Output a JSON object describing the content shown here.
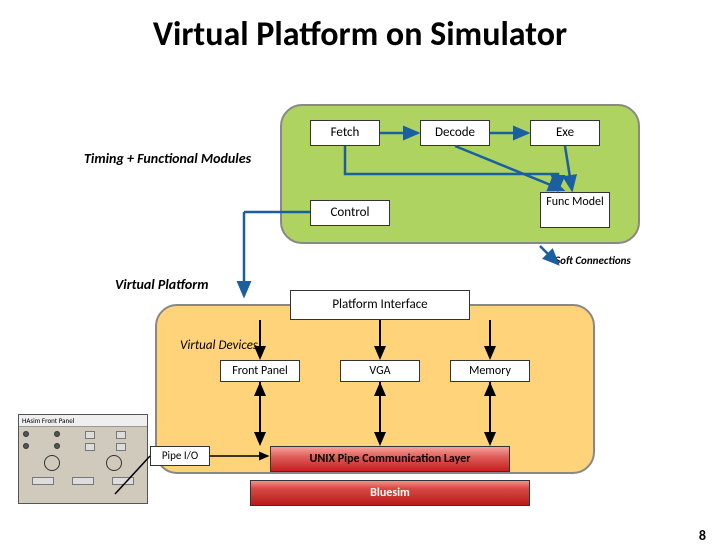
{
  "title": "Virtual Platform on Simulator",
  "timing_functional_label": "Timing + Functional Modules",
  "pipeline": {
    "fetch": "Fetch",
    "decode": "Decode",
    "exe": "Exe",
    "control": "Control",
    "func_model": "Func Model"
  },
  "soft_connections": "Soft Connections",
  "virtual_platform_label": "Virtual Platform",
  "platform_interface": "Platform Interface",
  "virtual_devices_label": "Virtual Devices",
  "devices": {
    "front_panel": "Front Panel",
    "vga": "VGA",
    "memory": "Memory"
  },
  "pipe_io": "Pipe I/O",
  "unix_layer": "UNIX Pipe Communication Layer",
  "bluesim": "Bluesim",
  "front_panel_window_title": "HAsim Front Panel",
  "page_number": "8"
}
